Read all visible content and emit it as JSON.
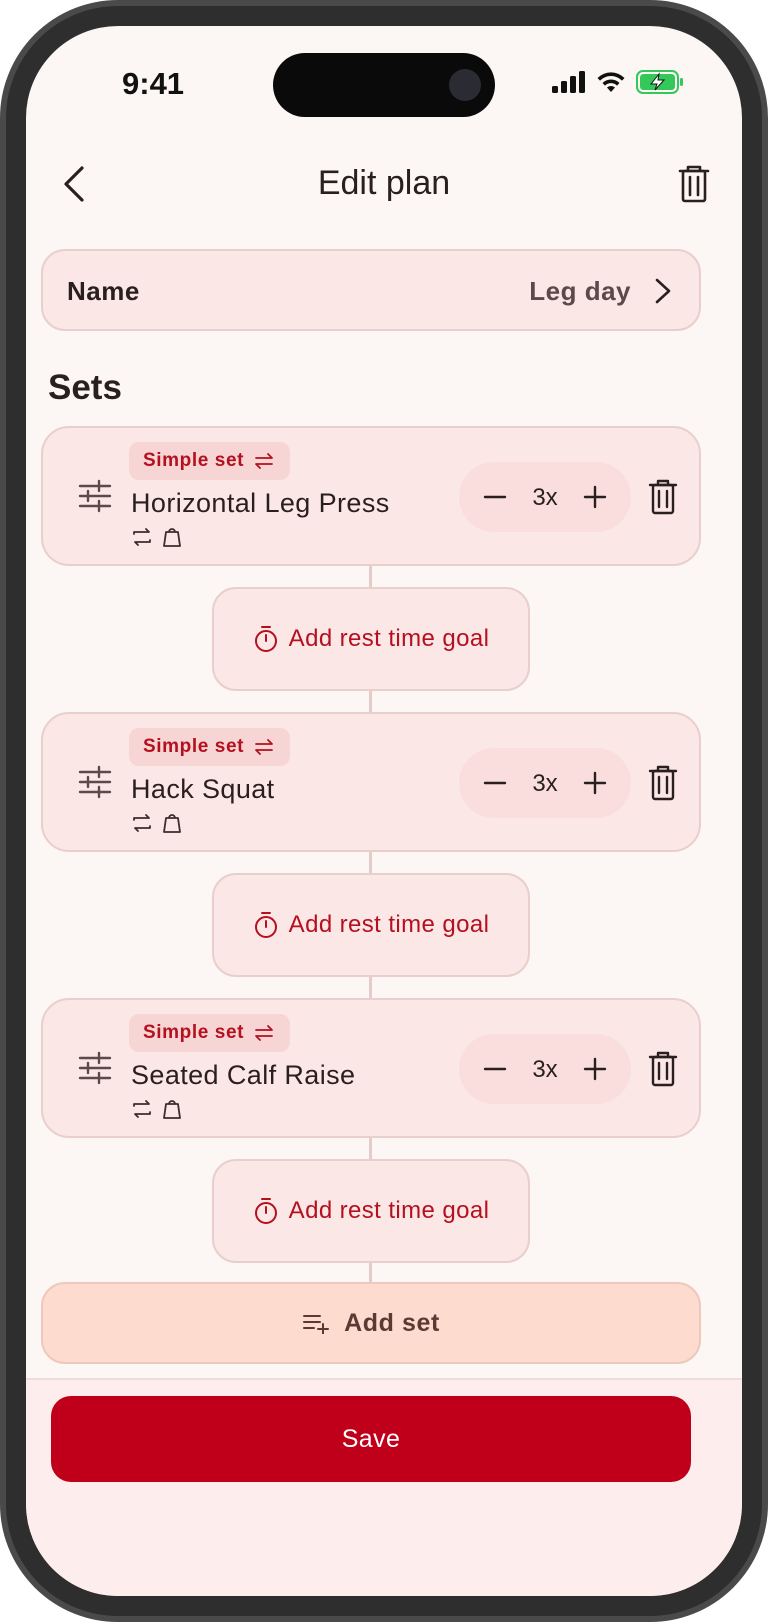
{
  "status_bar": {
    "time": "9:41",
    "icons": [
      "signal-icon",
      "wifi-icon",
      "battery-charging-icon"
    ]
  },
  "nav": {
    "title": "Edit plan",
    "back_icon": "chevron-left-icon",
    "delete_icon": "trash-icon"
  },
  "plan": {
    "name_label": "Name",
    "name_value": "Leg day"
  },
  "sets_section": {
    "title": "Sets",
    "sets": [
      {
        "badge": "Simple set",
        "exercise": "Horizontal Leg Press",
        "count": "3x"
      },
      {
        "badge": "Simple set",
        "exercise": "Hack Squat",
        "count": "3x"
      },
      {
        "badge": "Simple set",
        "exercise": "Seated Calf Raise",
        "count": "3x"
      }
    ],
    "rest_label": "Add rest time goal"
  },
  "add_set": {
    "label": "Add set"
  },
  "footer": {
    "save_label": "Save"
  },
  "colors": {
    "accent": "#c0001a",
    "card_bg": "#fbe7e6",
    "badge_text": "#b5101f",
    "add_set_bg": "#fddccf",
    "screen_bg": "#fcf6f4"
  }
}
